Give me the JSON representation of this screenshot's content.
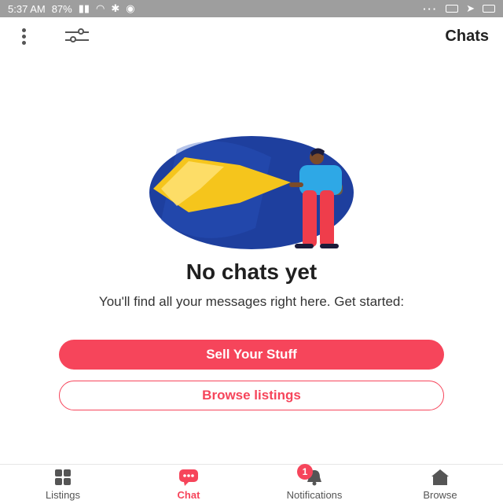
{
  "status_bar": {
    "time": "5:37 AM",
    "battery": "87%"
  },
  "header": {
    "title": "Chats"
  },
  "empty_state": {
    "title": "No chats yet",
    "description": "You'll find all your messages right here. Get started:",
    "primary_button": "Sell Your Stuff",
    "secondary_button": "Browse listings"
  },
  "bottom_nav": {
    "items": [
      {
        "label": "Listings",
        "icon": "grid-icon"
      },
      {
        "label": "Chat",
        "icon": "chat-bubble-icon"
      },
      {
        "label": "Notifications",
        "icon": "bell-icon",
        "badge": "1"
      },
      {
        "label": "Browse",
        "icon": "home-icon"
      }
    ]
  },
  "colors": {
    "accent": "#f6455b",
    "status_bar": "#9e9e9e"
  }
}
